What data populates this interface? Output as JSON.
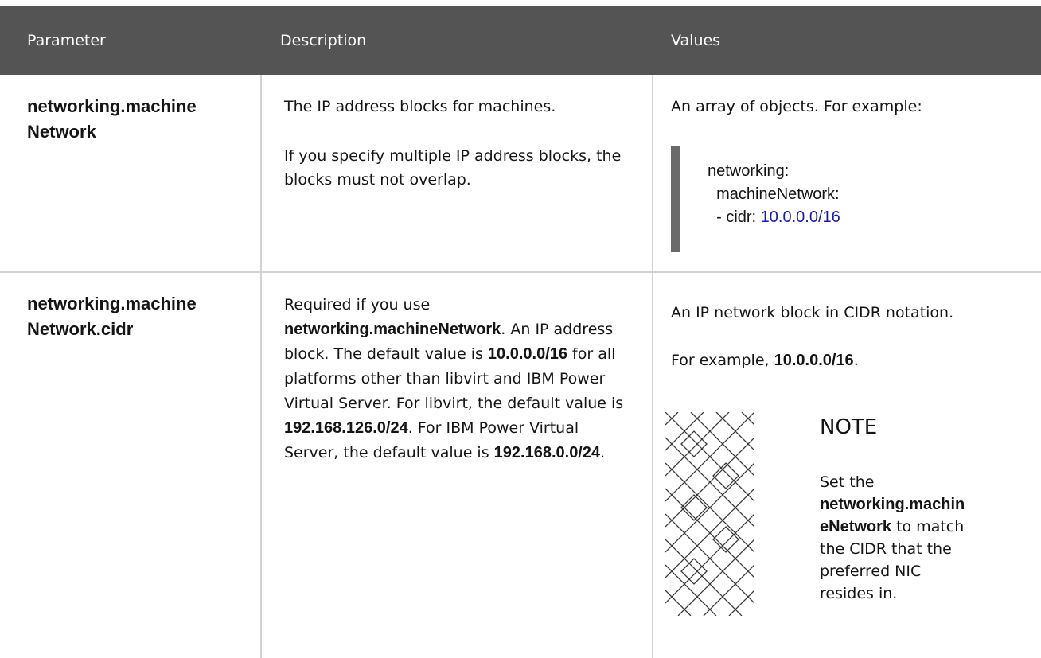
{
  "table": {
    "headers": [
      "Parameter",
      "Description",
      "Values"
    ],
    "rows": [
      {
        "parameter_line1": "networking.machine",
        "parameter_line2": "Network",
        "description": [
          "The IP address blocks for machines.",
          "If you specify multiple IP address blocks, the blocks must not overlap."
        ],
        "values_intro": "An array of objects. For example:",
        "code": {
          "line1": "networking:",
          "line2": "  machineNetwork:",
          "line3_prefix": "  - cidr: ",
          "line3_value": "10.0.0.0/16"
        }
      },
      {
        "parameter_line1": "networking.machine",
        "parameter_line2": "Network.cidr",
        "description": {
          "t1": "Required if you use ",
          "b1": "networking.machineNetwork",
          "t2": ". An IP address block. The default value is ",
          "b2": "10.0.0.0/16",
          "t3": " for all platforms other than libvirt and IBM Power Virtual Server. For libvirt, the default value is ",
          "b3": "192.168.126.0/24",
          "t4": ". For IBM Power Virtual Server, the default value is ",
          "b4": "192.168.0.0/24",
          "t5": "."
        },
        "values_intro": "An IP network block in CIDR notation.",
        "example_prefix": "For example, ",
        "example_value": "10.0.0.0/16",
        "example_suffix": ".",
        "note": {
          "title": "NOTE",
          "t1": "Set the ",
          "b1": "networking.machin eNetwork",
          "t2": " to match the CIDR that the preferred NIC resides in."
        }
      }
    ]
  }
}
